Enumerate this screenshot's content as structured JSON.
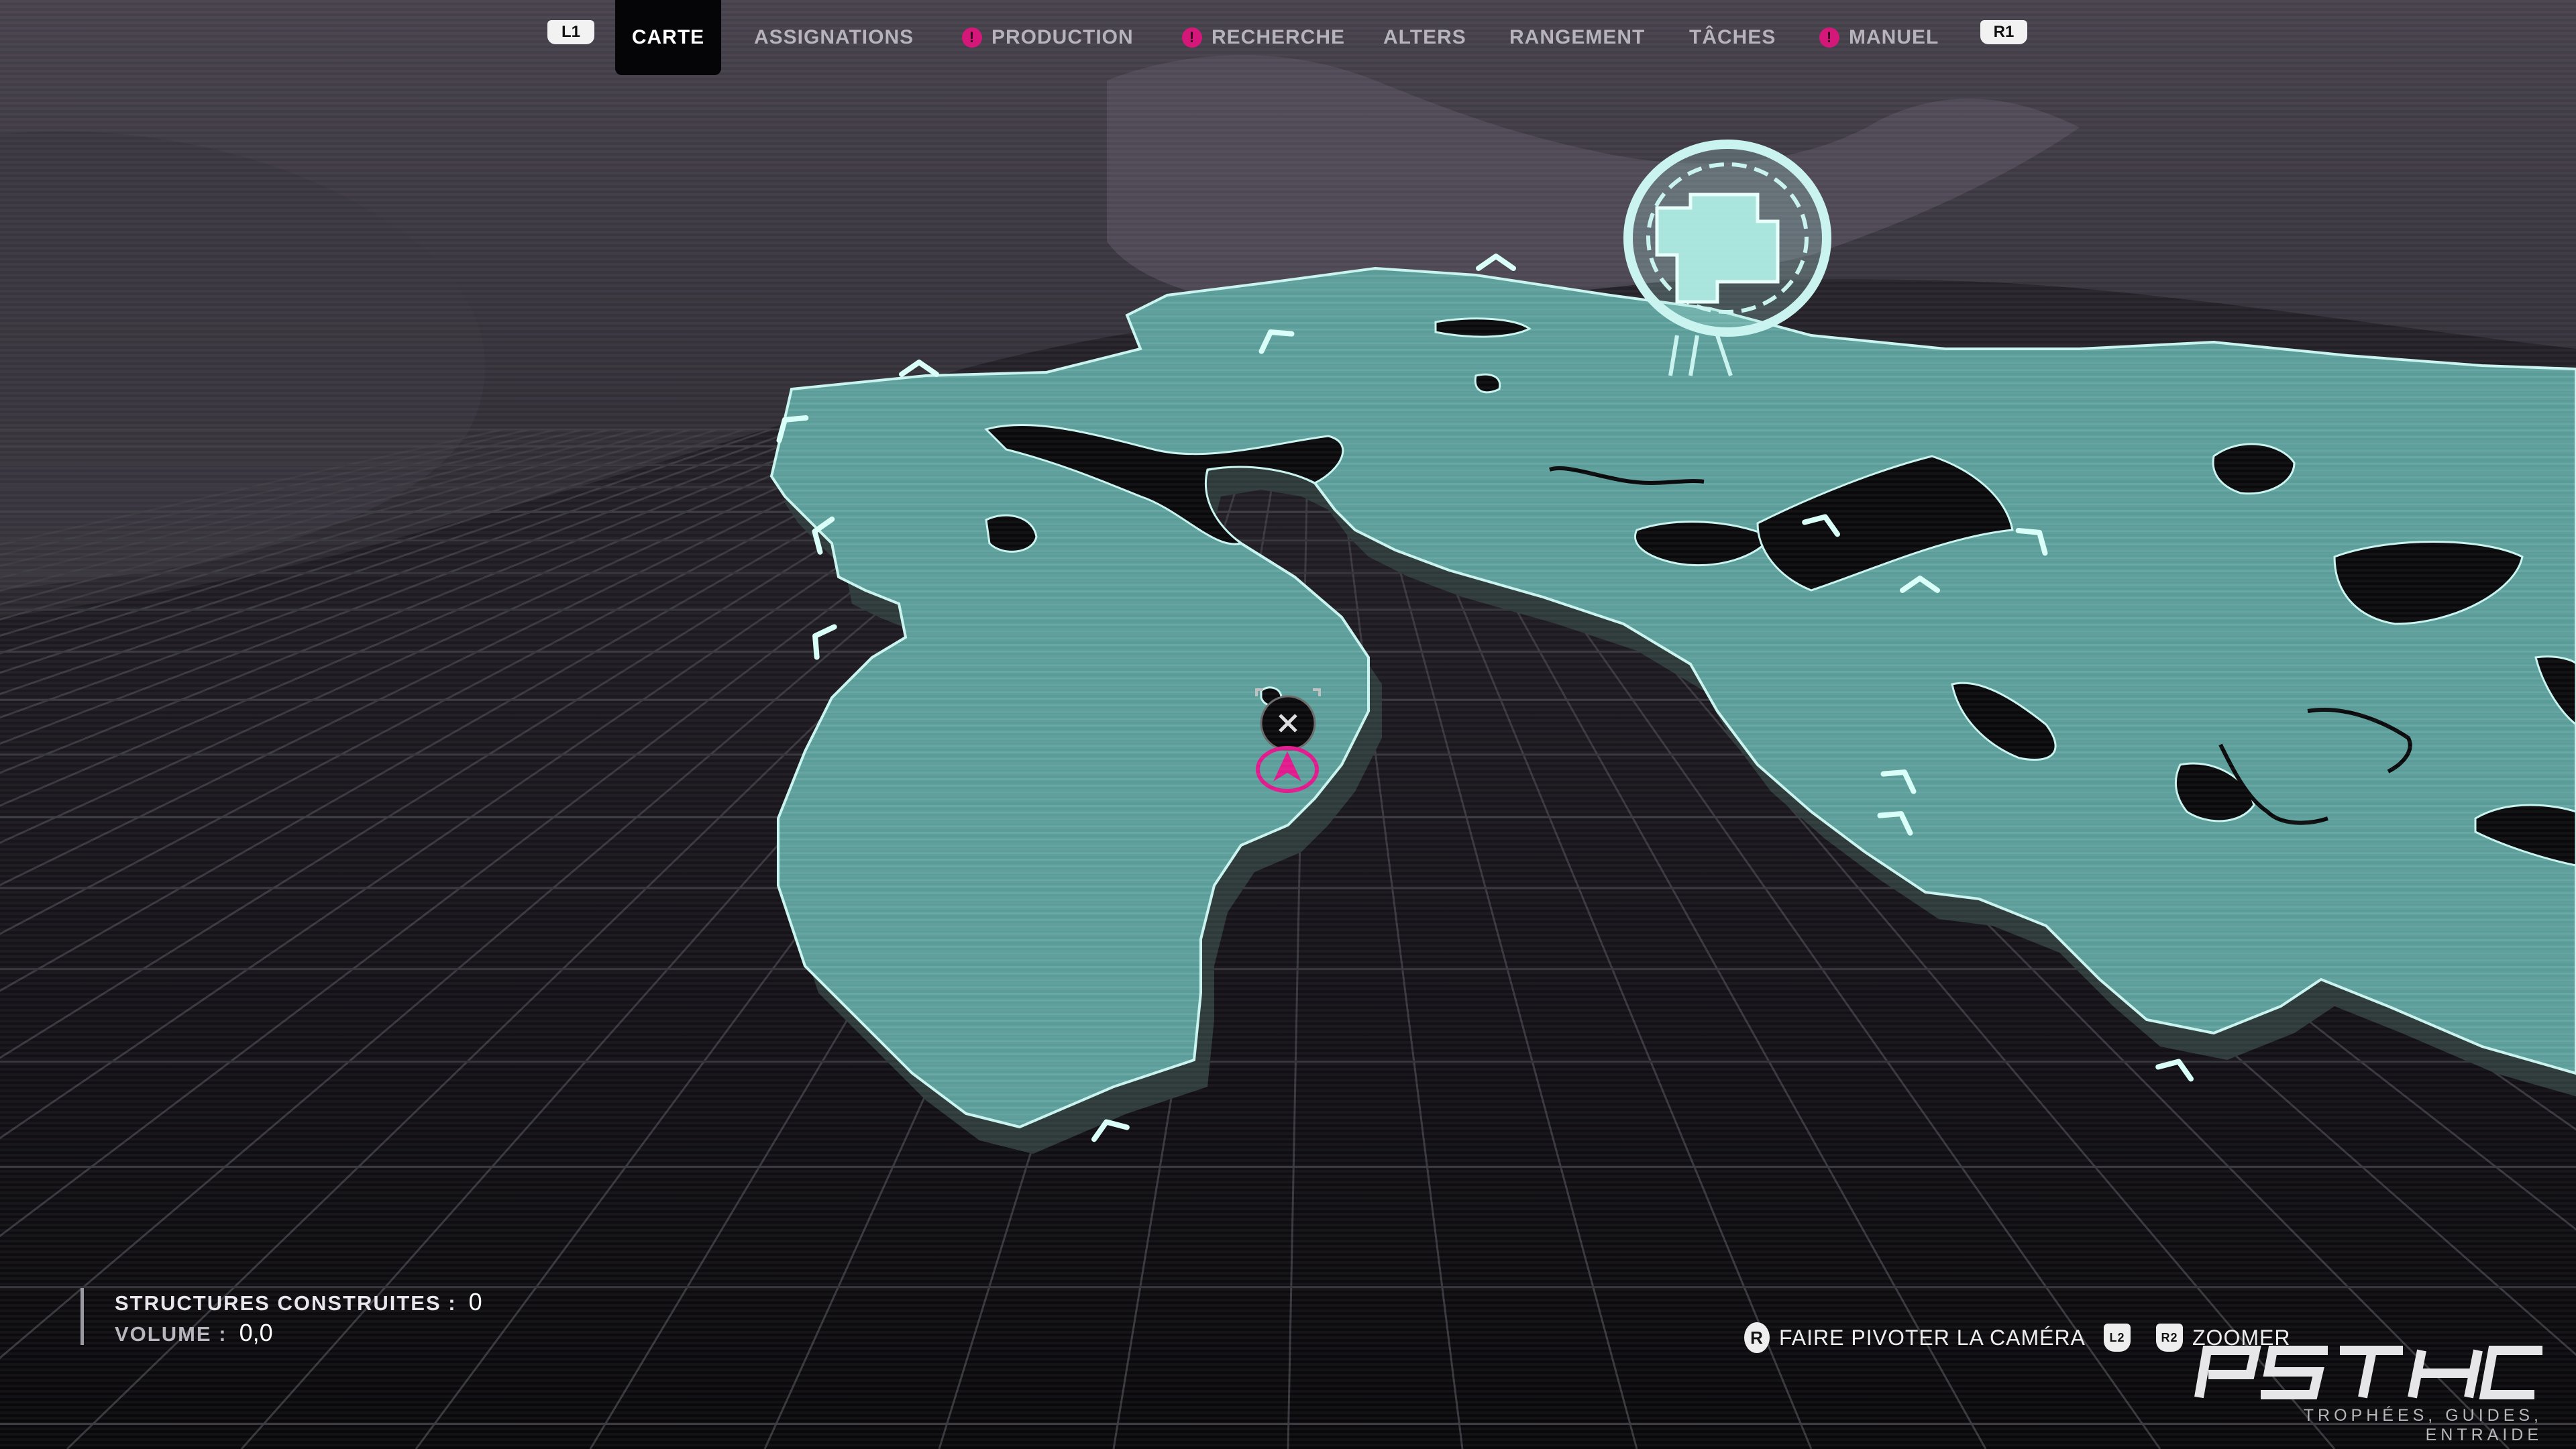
{
  "nav": {
    "left_shoulder": "L1",
    "right_shoulder": "R1",
    "tabs": [
      {
        "label": "CARTE",
        "active": true,
        "alert": false
      },
      {
        "label": "ASSIGNATIONS",
        "active": false,
        "alert": false
      },
      {
        "label": "PRODUCTION",
        "active": false,
        "alert": true
      },
      {
        "label": "RECHERCHE",
        "active": false,
        "alert": true
      },
      {
        "label": "ALTERS",
        "active": false,
        "alert": false
      },
      {
        "label": "RANGEMENT",
        "active": false,
        "alert": false
      },
      {
        "label": "TÂCHES",
        "active": false,
        "alert": false
      },
      {
        "label": "MANUEL",
        "active": false,
        "alert": true
      }
    ],
    "alert_glyph": "!"
  },
  "stats": {
    "structures_label": "STRUCTURES CONSTRUITES :",
    "structures_value": "0",
    "volume_label": "VOLUME :",
    "volume_value": "0,0"
  },
  "controls": {
    "rotate_button": "R",
    "rotate_label": "FAIRE PIVOTER LA CAMÉRA",
    "zoom_buttons": [
      "L2",
      "R2"
    ],
    "zoom_label": "ZOOMER"
  },
  "map": {
    "player_marker_icon": "player-arrow-icon",
    "waypoint_icon": "close-x-icon",
    "point_of_interest_icon": "ringed-structure-icon",
    "direction_icon": "chevron-icon"
  },
  "colors": {
    "land": "#5a9c98",
    "land_edge": "#c9f3ee",
    "water": "#0a0a0c",
    "grid": "#3c3c42",
    "accent_alert": "#d6177a",
    "player": "#e01a8c",
    "nav_text": "#b7b3bd"
  },
  "watermark": {
    "logo_text": "PSTHC",
    "tagline": "TROPHÉES, GUIDES, ENTRAIDE"
  }
}
